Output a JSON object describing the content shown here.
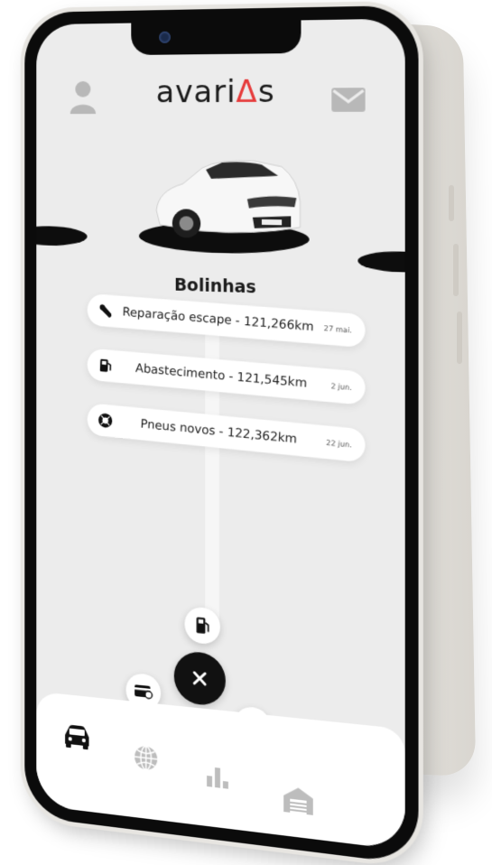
{
  "app": {
    "logo_prefix": "avari",
    "logo_accent": "Δ",
    "logo_suffix": "s"
  },
  "header": {
    "user_icon": "user-icon",
    "mail_icon": "mail-icon"
  },
  "vehicle": {
    "name": "Bolinhas"
  },
  "events": [
    {
      "icon": "wrench-icon",
      "text": "Reparação escape - 121,266km",
      "date": "27 mai."
    },
    {
      "icon": "fuel-pump-icon",
      "text": "Abastecimento - 121,545km",
      "date": "2 jun."
    },
    {
      "icon": "tire-icon",
      "text": "Pneus novos - 122,362km",
      "date": "22 jun."
    }
  ],
  "fab_menu": {
    "main": "close-icon",
    "actions": [
      "fuel-pump-icon",
      "card-icon",
      "wrench-icon"
    ]
  },
  "bottom_nav": {
    "items": [
      "car-icon",
      "globe-icon",
      "stats-icon",
      "garage-icon"
    ],
    "active": "car-icon"
  },
  "colors": {
    "accent": "#e63a3a",
    "screen_bg": "#ececec",
    "dark": "#111111"
  }
}
